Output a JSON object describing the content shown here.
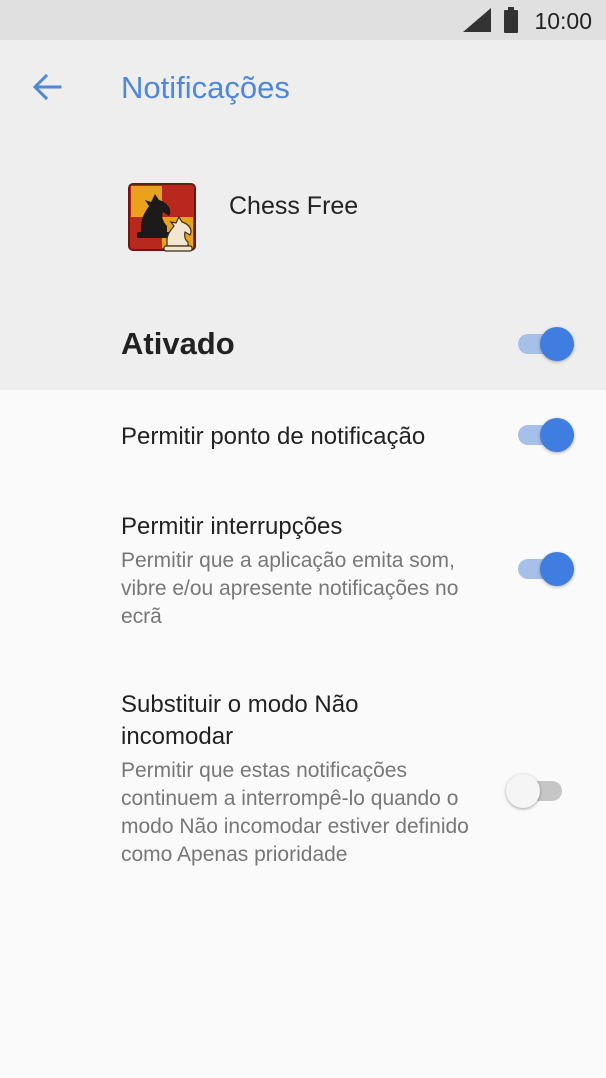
{
  "status_bar": {
    "time": "10:00",
    "icons": [
      "signal-icon",
      "battery-icon"
    ]
  },
  "header": {
    "title": "Notificações",
    "back_icon": "arrow-left-icon"
  },
  "app": {
    "name": "Chess Free",
    "icon": "chess-knights-icon"
  },
  "main_toggle": {
    "label": "Ativado",
    "on": true
  },
  "settings": [
    {
      "title": "Permitir ponto de notificação",
      "description": "",
      "on": true
    },
    {
      "title": "Permitir interrupções",
      "description": "Permitir que a aplicação emita som, vibre e/ou apresente notificações no ecrã",
      "on": true
    },
    {
      "title": "Substituir o modo Não incomodar",
      "description": "Permitir que estas notificações continuem a interrompê-lo quando o modo Não incomodar estiver definido como Apenas prioridade",
      "on": false
    }
  ],
  "colors": {
    "accent": "#4f87da",
    "switch_thumb_on": "#3f7ee0",
    "switch_track_on": "#a7c0ea",
    "header_bg": "#eeeeee",
    "body_bg": "#fafafa"
  }
}
